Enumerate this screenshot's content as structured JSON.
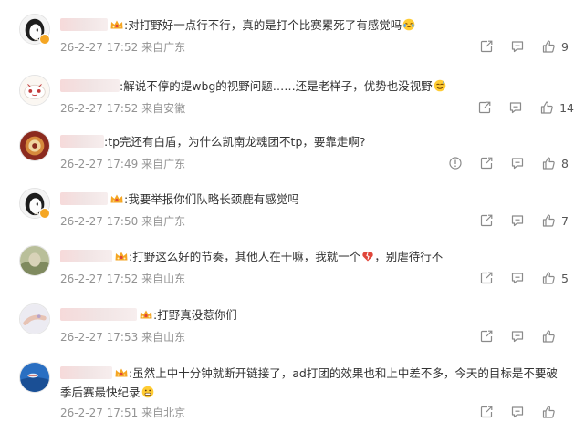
{
  "colors": {
    "meta_text": "#939393",
    "username_blur": "#f3dcdc",
    "vip_crown": "#f5a623",
    "body_text": "#333333"
  },
  "icons": {
    "share": "share-icon",
    "reply": "comment-icon",
    "like": "thumbs-up-icon",
    "report": "report-icon"
  },
  "comments": [
    {
      "separator": ":",
      "text": "对打野好一点行不行，真的是打个比赛累死了有感觉吗",
      "emoji": "crying-laughing-emoji",
      "time": "26-2-27 17:52",
      "location": "来自广东",
      "likes": "9",
      "vip": true
    },
    {
      "separator": ":",
      "text": "解说不停的提wbg的视野问题……还是老样子，优势也没视野",
      "emoji": "sweat-smile-emoji",
      "time": "26-2-27 17:52",
      "location": "来自安徽",
      "likes": "14",
      "vip": false
    },
    {
      "separator": ":",
      "text": "tp完还有白盾，为什么凯南龙魂团不tp，要靠走啊?",
      "emoji": "",
      "time": "26-2-27 17:49",
      "location": "来自广东",
      "likes": "8",
      "vip": false
    },
    {
      "separator": ":",
      "text": "我要举报你们队略长颈鹿有感觉吗",
      "emoji": "",
      "time": "26-2-27 17:50",
      "location": "来自广东",
      "likes": "7",
      "vip": true
    },
    {
      "separator": ":",
      "text_before": "打野这么好的节奏，其他人在干嘛，我就一个",
      "text_after": "，别虐待行不",
      "emoji": "heartbreak-emoji",
      "time": "26-2-27 17:52",
      "location": "来自山东",
      "likes": "5",
      "vip": true
    },
    {
      "separator": ":",
      "text": "打野真没惹你们",
      "emoji": "",
      "time": "26-2-27 17:53",
      "location": "来自山东",
      "likes": "",
      "vip": true
    },
    {
      "separator": ":",
      "text": "虽然上中十分钟就断开链接了，ad打团的效果也和上中差不多，今天的目标是不要破季后赛最快纪录",
      "emoji": "grimace-emoji",
      "time": "26-2-27 17:51",
      "location": "来自北京",
      "likes": "",
      "vip": true
    }
  ]
}
